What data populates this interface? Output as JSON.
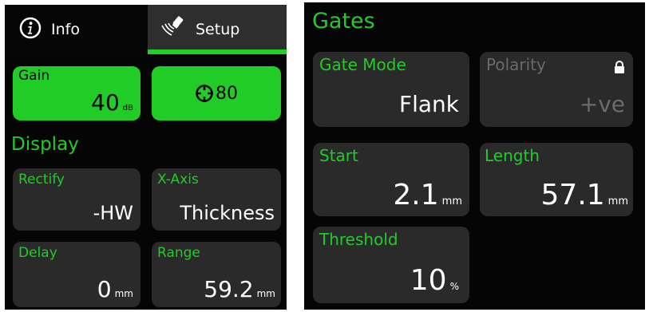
{
  "tabs": [
    {
      "label": "Info",
      "icon": "info-icon"
    },
    {
      "label": "Setup",
      "icon": "probe-signal-icon",
      "active": true
    }
  ],
  "left": {
    "gain": {
      "label": "Gain",
      "value": "40",
      "unit": "dB"
    },
    "target_button": {
      "icon": "crosshair-icon",
      "value": "80"
    },
    "display_title": "Display",
    "rectify": {
      "label": "Rectify",
      "value": "-HW"
    },
    "x_axis": {
      "label": "X-Axis",
      "value": "Thickness"
    },
    "delay": {
      "label": "Delay",
      "value": "0",
      "unit": "mm"
    },
    "range": {
      "label": "Range",
      "value": "59.2",
      "unit": "mm"
    }
  },
  "right": {
    "title": "Gates",
    "gate_mode": {
      "label": "Gate Mode",
      "value": "Flank"
    },
    "polarity": {
      "label": "Polarity",
      "value": "+ve",
      "locked": true,
      "icon": "lock-icon"
    },
    "start": {
      "label": "Start",
      "value": "2.1",
      "unit": "mm"
    },
    "length": {
      "label": "Length",
      "value": "57.1",
      "unit": "mm"
    },
    "threshold": {
      "label": "Threshold",
      "value": "10",
      "unit": "%"
    }
  },
  "colors": {
    "accent": "#21cc27",
    "background": "#050505",
    "card": "#2a2a2a",
    "tab_active": "#2e2e2e",
    "text": "#ffffff",
    "disabled": "#6b6b6b"
  }
}
